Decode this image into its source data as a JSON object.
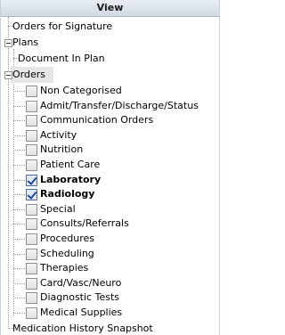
{
  "header": {
    "title": "View"
  },
  "tree": {
    "orders_for_signature": "Orders for Signature",
    "plans": {
      "label": "Plans",
      "children": [
        "Document In Plan"
      ]
    },
    "orders": {
      "label": "Orders",
      "items": [
        {
          "label": "Non Categorised",
          "checked": false
        },
        {
          "label": "Admit/Transfer/Discharge/Status",
          "checked": false
        },
        {
          "label": "Communication Orders",
          "checked": false
        },
        {
          "label": "Activity",
          "checked": false
        },
        {
          "label": "Nutrition",
          "checked": false
        },
        {
          "label": "Patient Care",
          "checked": false
        },
        {
          "label": "Laboratory",
          "checked": true
        },
        {
          "label": "Radiology",
          "checked": true
        },
        {
          "label": "Special",
          "checked": false
        },
        {
          "label": "Consults/Referrals",
          "checked": false
        },
        {
          "label": "Procedures",
          "checked": false
        },
        {
          "label": "Scheduling",
          "checked": false
        },
        {
          "label": "Therapies",
          "checked": false
        },
        {
          "label": "Card/Vasc/Neuro",
          "checked": false
        },
        {
          "label": "Diagnostic Tests",
          "checked": false
        },
        {
          "label": "Medical Supplies",
          "checked": false
        }
      ]
    },
    "medication_history": "Medication History Snapshot"
  }
}
